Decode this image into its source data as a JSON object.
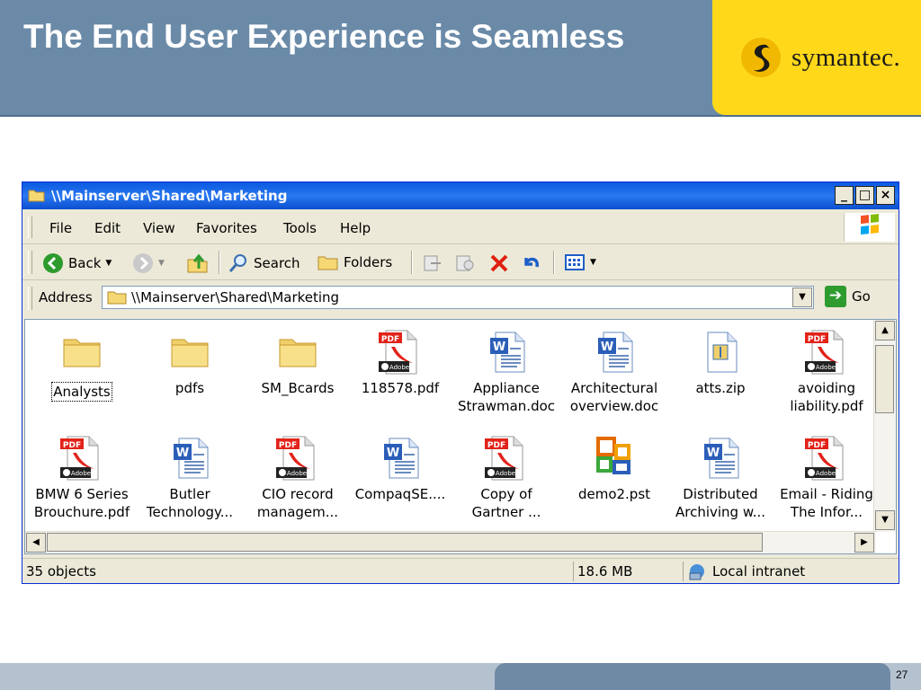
{
  "slide": {
    "title": "The End User Experience is Seamless",
    "brand": "symantec.",
    "page_number": "27"
  },
  "window": {
    "title": "\\\\Mainserver\\Shared\\Marketing",
    "caption_buttons": [
      "_",
      "□",
      "×"
    ],
    "menu": [
      "File",
      "Edit",
      "View",
      "Favorites",
      "Tools",
      "Help"
    ],
    "toolbar": {
      "back": "Back",
      "search": "Search",
      "folders": "Folders"
    },
    "address": {
      "label": "Address",
      "value": "\\\\Mainserver\\Shared\\Marketing",
      "go": "Go"
    },
    "files": [
      {
        "name": "Analysts",
        "type": "folder",
        "selected": true
      },
      {
        "name": "pdfs",
        "type": "folder"
      },
      {
        "name": "SM_Bcards",
        "type": "folder"
      },
      {
        "name": "118578.pdf",
        "type": "pdf"
      },
      {
        "name": "Appliance Strawman.doc",
        "line1": "Appliance",
        "line2": "Strawman.doc",
        "type": "doc"
      },
      {
        "name": "Architectural overview.doc",
        "line1": "Architectural",
        "line2": "overview.doc",
        "type": "doc"
      },
      {
        "name": "atts.zip",
        "type": "zip"
      },
      {
        "name": "avoiding liability.pdf",
        "line1": "avoiding",
        "line2": "liability.pdf",
        "type": "pdf"
      },
      {
        "name": "BMW 6 Series Brouchure.pdf",
        "line1": "BMW 6 Series",
        "line2": "Brouchure.pdf",
        "type": "pdf"
      },
      {
        "name": "Butler Technology...",
        "line1": "Butler",
        "line2": "Technology...",
        "type": "doc"
      },
      {
        "name": "CIO record managem...",
        "line1": "CIO record",
        "line2": "managem...",
        "type": "pdf"
      },
      {
        "name": "CompaqSE....",
        "type": "doc"
      },
      {
        "name": "Copy of Gartner ...",
        "line1": "Copy of",
        "line2": "Gartner ...",
        "type": "pdf"
      },
      {
        "name": "demo2.pst",
        "type": "pst"
      },
      {
        "name": "Distributed Archiving w...",
        "line1": "Distributed",
        "line2": "Archiving w...",
        "type": "doc"
      },
      {
        "name": "Email - Riding The Infor...",
        "line1": "Email - Riding",
        "line2": "The Infor...",
        "type": "pdf"
      }
    ],
    "status": {
      "objects": "35 objects",
      "size": "18.6 MB",
      "zone": "Local intranet"
    }
  }
}
